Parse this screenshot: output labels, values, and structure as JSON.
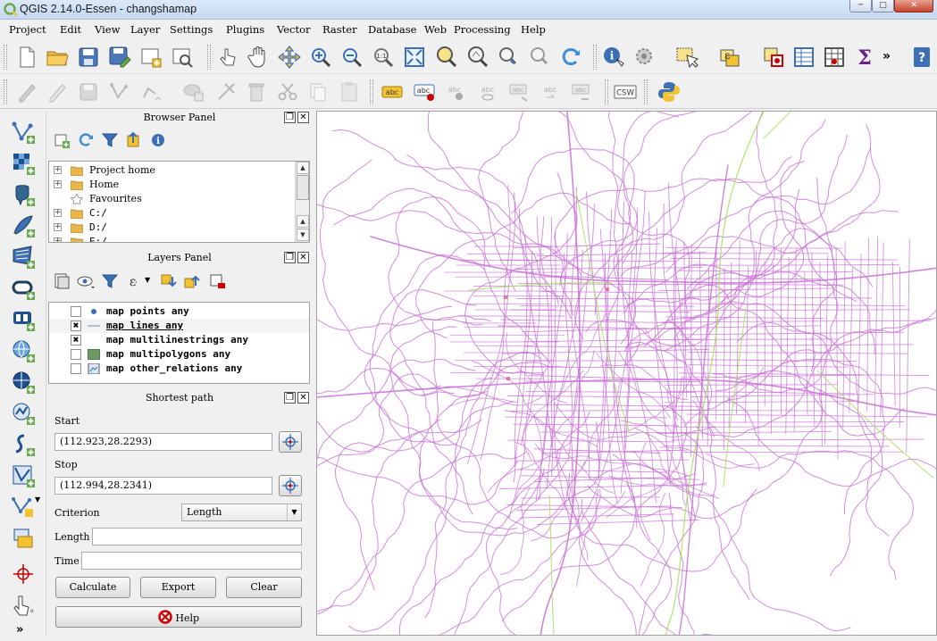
{
  "window": {
    "title": "QGIS 2.14.0-Essen - changshamap",
    "minimize_glyph": "─",
    "maximize_glyph": "□",
    "close_glyph": "✕"
  },
  "menu": [
    "Project",
    "Edit",
    "View",
    "Layer",
    "Settings",
    "Plugins",
    "Vector",
    "Raster",
    "Database",
    "Web",
    "Processing",
    "Help"
  ],
  "toolbar1": {
    "icons": [
      "new-project-icon",
      "open-project-icon",
      "save-project-icon",
      "save-as-icon",
      "new-print-composer-icon",
      "composer-manager-icon",
      "touch-zoom-icon",
      "pan-icon",
      "pan-to-selection-icon",
      "zoom-in-icon",
      "zoom-out-icon",
      "zoom-native-icon",
      "zoom-full-icon",
      "zoom-to-selection-icon",
      "zoom-to-layer-icon",
      "zoom-last-icon",
      "zoom-next-icon",
      "refresh-icon",
      "identify-icon",
      "action-icon",
      "select-features-icon",
      "select-by-expression-icon",
      "deselect-icon",
      "attribute-table-icon",
      "field-calculator-icon",
      "statistics-icon",
      "more-icon",
      "whats-this-icon"
    ],
    "overflow_glyph": "»"
  },
  "toolbar2": {
    "icons": [
      "current-edits-icon",
      "toggle-editing-icon",
      "save-edits-icon",
      "add-feature-icon",
      "move-feature-icon",
      "node-tool-icon",
      "delete-selected-icon",
      "cut-features-icon",
      "copy-features-icon",
      "paste-features-icon",
      "label-icon",
      "pin-label-icon",
      "show-hide-labels-icon",
      "move-label-icon",
      "rotate-label-icon",
      "change-label-icon",
      "python-console-icon"
    ],
    "label_icon_text": "abc",
    "csw_label": "CSW"
  },
  "left_toolbar": {
    "icons": [
      "add-vector-layer-icon",
      "add-raster-layer-icon",
      "add-postgis-icon",
      "add-spatialite-icon",
      "add-mssql-icon",
      "add-oracle-icon",
      "add-db2-icon",
      "add-wms-icon",
      "add-wcs-icon",
      "add-wfs-icon",
      "add-delimited-text-icon",
      "add-virtual-layer-icon",
      "new-shapefile-icon",
      "add-memory-layer-icon",
      "georeferencer-icon",
      "gps-tool-icon",
      "more-tools-icon"
    ],
    "more_glyph": "»"
  },
  "browser_panel": {
    "title": "Browser Panel",
    "float_glyph": "❐",
    "close_glyph": "✕",
    "tools": [
      "add-layer-icon",
      "refresh-icon",
      "filter-icon",
      "collapse-all-icon",
      "properties-icon"
    ],
    "items": [
      {
        "label": "Project home",
        "expander": "+"
      },
      {
        "label": "Home",
        "expander": "+"
      },
      {
        "label": "Favourites",
        "expander": ""
      },
      {
        "label": "C:/",
        "expander": "+"
      },
      {
        "label": "D:/",
        "expander": "+"
      },
      {
        "label": "E:/",
        "expander": "+"
      }
    ],
    "scroll_up": "▲",
    "scroll_down": "▼"
  },
  "layers_panel": {
    "title": "Layers Panel",
    "float_glyph": "❐",
    "close_glyph": "✕",
    "tools": [
      "open-layer-styling-icon",
      "manage-map-themes-icon",
      "filter-legend-icon",
      "filter-by-expression-icon",
      "expand-all-icon",
      "collapse-all-icon",
      "remove-layer-icon"
    ],
    "layers": [
      {
        "label": "map points any",
        "checked": "",
        "symbol": "point"
      },
      {
        "label": "map lines any",
        "checked": "✖",
        "symbol": "line"
      },
      {
        "label": "map multilinestrings any",
        "checked": "✖",
        "symbol": "none"
      },
      {
        "label": "map multipolygons any",
        "checked": "",
        "symbol": "polygon"
      },
      {
        "label": "map other_relations any",
        "checked": "",
        "symbol": "raster"
      }
    ]
  },
  "shortest_path": {
    "title": "Shortest path",
    "float_glyph": "❐",
    "close_glyph": "✕",
    "start_label": "Start",
    "start_value": "(112.923,28.2293)",
    "stop_label": "Stop",
    "stop_value": "(112.994,28.2341)",
    "criterion_label": "Criterion",
    "criterion_value": "Length",
    "length_label": "Length",
    "length_value": "",
    "time_label": "Time",
    "time_value": "",
    "calculate_label": "Calculate",
    "export_label": "Export",
    "clear_label": "Clear",
    "help_label": "Help"
  },
  "map": {
    "road_color": "#c86fd6",
    "secondary_color": "#a5e05e",
    "point_color": "#e25b8c",
    "background": "#ffffff"
  }
}
